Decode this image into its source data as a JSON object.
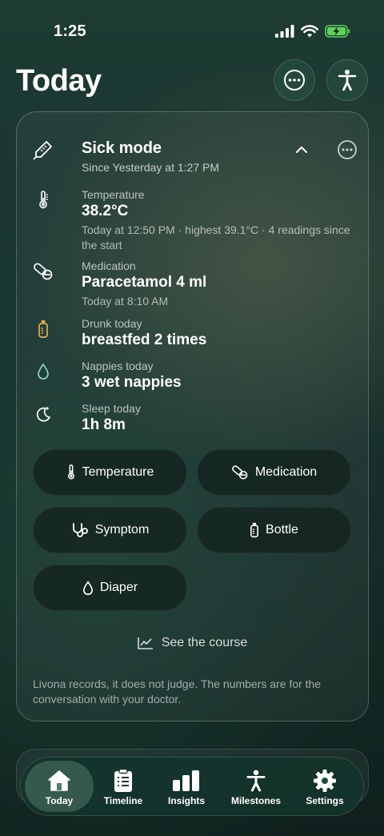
{
  "status": {
    "time": "1:25"
  },
  "header": {
    "title": "Today"
  },
  "card": {
    "title": "Sick mode",
    "subtitle": "Since Yesterday at 1:27 PM",
    "stats": [
      {
        "label": "Temperature",
        "value": "38.2°C",
        "detail": "Today at 12:50 PM · highest 39.1°C · 4 readings since the start",
        "icon": "thermometer-icon"
      },
      {
        "label": "Medication",
        "value": "Paracetamol 4 ml",
        "detail": "Today at 8:10 AM",
        "icon": "pills-icon"
      },
      {
        "label": "Drunk today",
        "value": "breastfed 2 times",
        "detail": "",
        "icon": "bottle-icon"
      },
      {
        "label": "Nappies today",
        "value": "3 wet nappies",
        "detail": "",
        "icon": "drop-icon"
      },
      {
        "label": "Sleep today",
        "value": "1h 8m",
        "detail": "",
        "icon": "moon-icon"
      }
    ],
    "actions": {
      "temperature": "Temperature",
      "medication": "Medication",
      "symptom": "Symptom",
      "bottle": "Bottle",
      "diaper": "Diaper"
    },
    "see_course": "See the course",
    "footnote": "Livona records, it does not judge. The numbers are for the conversation with your doctor."
  },
  "tabs": {
    "today": "Today",
    "timeline": "Timeline",
    "insights": "Insights",
    "milestones": "Milestones",
    "settings": "Settings"
  },
  "colors": {
    "accent_bottle": "#e8a94a",
    "accent_drop": "#8fd6c4",
    "battery": "#5fd35a"
  }
}
